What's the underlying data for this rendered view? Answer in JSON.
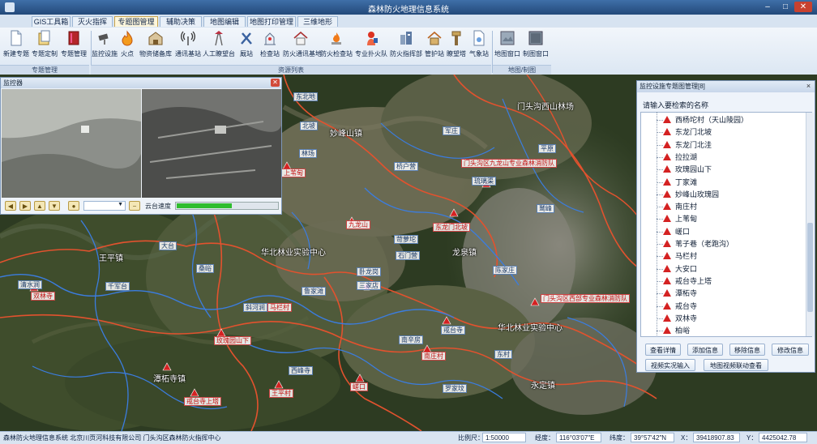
{
  "window": {
    "title": "森林防火地理信息系统"
  },
  "tabs": [
    {
      "label": "GIS工具箱",
      "active": false
    },
    {
      "label": "灭火指挥",
      "active": false
    },
    {
      "label": "专题图管理",
      "active": true
    },
    {
      "label": "辅助决策",
      "active": false
    },
    {
      "label": "地图编辑",
      "active": false
    },
    {
      "label": "地图打印管理",
      "active": false
    },
    {
      "label": "三维地形",
      "active": false
    }
  ],
  "ribbon": {
    "buttons": [
      {
        "label": "新建专题"
      },
      {
        "label": "专题定制"
      },
      {
        "label": "专题管理"
      },
      {
        "label": "监控设施"
      },
      {
        "label": "火点"
      },
      {
        "label": "物资储备库"
      },
      {
        "label": "通讯基站"
      },
      {
        "label": "人工瞭望台"
      },
      {
        "label": "厩站"
      },
      {
        "label": "检查站"
      },
      {
        "label": "防火通讯基地"
      },
      {
        "label": "防火检查站"
      },
      {
        "label": "专业扑火队"
      },
      {
        "label": "防火指挥部"
      },
      {
        "label": "管护站"
      },
      {
        "label": "瞭望塔"
      },
      {
        "label": "气象站"
      },
      {
        "label": "地图窗口"
      },
      {
        "label": "制图窗口"
      }
    ],
    "groups": [
      {
        "label": "专题管理"
      },
      {
        "label": "资源列表"
      },
      {
        "label": "地图/制图"
      }
    ]
  },
  "video_window": {
    "title": "监控器",
    "ptz_label": "云台速度",
    "ptz_speed_percent": 55
  },
  "panel": {
    "title": "监控设施专题图管理[8]",
    "search_label": "请输入要检索的名称",
    "items": [
      "西杨坨村（天山陵园）",
      "东龙门北坡",
      "东龙门北洼",
      "拉拉湖",
      "玫瑰园山下",
      "丁家滩",
      "妙峰山玫瑰园",
      "南庄村",
      "上苇甸",
      "嵯口",
      "苇子巷（老跑沟）",
      "马栏村",
      "大安口",
      "戒台寺上塔",
      "潭柘寺",
      "戒台寺",
      "双林寺",
      "柏峪"
    ],
    "buttons": [
      "查看详情",
      "添加信息",
      "移除信息",
      "修改信息",
      "视频实况输入",
      "地图视频联动查看"
    ]
  },
  "map": {
    "labels": {
      "miaofeng": "妙峰山镇",
      "xishan": "门头沟西山林场",
      "north_center_1": "华北林业实验中心",
      "north_center_2": "华北林业实验中心",
      "longquan": "龙泉镇",
      "yongding": "永定镇",
      "tanzhe": "潭柘寺镇",
      "fire_team_1": "门头沟区九龙山专业森林消防队",
      "fire_team_2": "门头沟区西部专业森林消防队",
      "wangpingzhen": "王平镇",
      "yanchi": "雁翅镇",
      "dongmen": "东龙门北洼",
      "jiulong": "九龙山",
      "xiang1": "永定河",
      "lianghe": "两河",
      "dahui": "大悲寺",
      "mafang": "马栏村",
      "b1": "东北地",
      "b2": "北坡",
      "b3": "林场",
      "b4": "桥户营",
      "b5": "三家店",
      "b6": "石门营",
      "b7": "陈家庄",
      "b8": "苛萝坨",
      "b9": "卧龙岗",
      "b10": "大台",
      "b11": "千军台",
      "b12": "清水涧",
      "b13": "军庄",
      "b14": "琉璃渠",
      "b15": "斜河涧",
      "b16": "桑峪",
      "b17": "鲁家滩",
      "b18": "戒台寺",
      "b19": "南辛房",
      "b20": "东村",
      "b21": "西峰寺",
      "b22": "罗家坟",
      "b23": "鹫峰",
      "b24": "平原",
      "r1": "南庄村",
      "r2": "马栏村",
      "r3": "玫瑰园山下",
      "r4": "戒台寺上塔",
      "r5": "双林寺",
      "r6": "潭柘寺",
      "r7": "上苇甸",
      "r8": "嵯口",
      "r9": "王平村",
      "r10": "东龙门北坡"
    }
  },
  "status": {
    "company": "森林防火地理信息系统  北京川页河科技有限公司  门头沟区森林防火指挥中心",
    "scale_label": "比例尺：",
    "scale_value": "1:50000",
    "lon_label": "经度：",
    "lon_value": "116°03′07″E",
    "lat_label": "纬度：",
    "lat_value": "39°57′42″N",
    "x_label": "X：",
    "x_value": "39418907.83",
    "y_label": "Y：",
    "y_value": "4425042.78"
  },
  "colors": {
    "accent": "#23497a",
    "river": "#3b7de0",
    "boundary": "#e2522e",
    "marker": "#d42222"
  }
}
